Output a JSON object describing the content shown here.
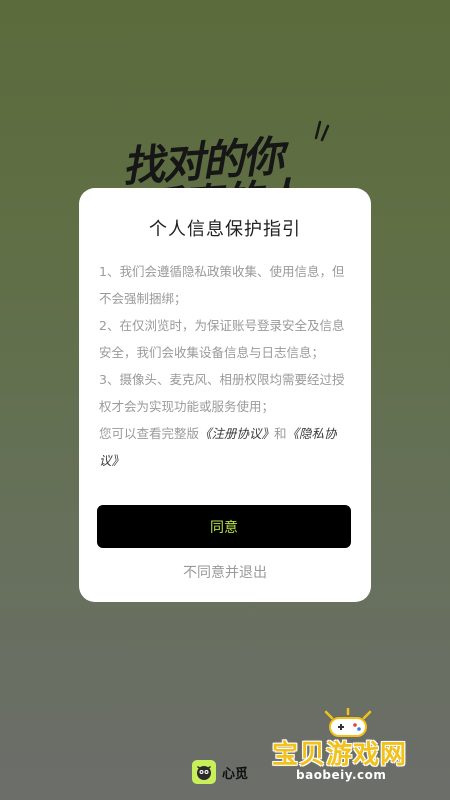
{
  "background": {
    "slogan_line1": "找对的你",
    "slogan_line2": "看真的人"
  },
  "dialog": {
    "title": "个人信息保护指引",
    "items": [
      "1、我们会遵循隐私政策收集、使用信息，但不会强制捆绑；",
      "2、在仅浏览时，为保证账号登录安全及信息安全，我们会收集设备信息与日志信息；",
      "3、摄像头、麦克风、相册权限均需要经过授权才会为实现功能或服务使用；"
    ],
    "footer_prefix": "您可以查看完整版",
    "register_link": "《注册协议》",
    "conjunction": "和",
    "privacy_link": "《隐私协议》",
    "agree_label": "同意",
    "disagree_label": "不同意并退出"
  },
  "brand": {
    "name": "心觅",
    "logo_color": "#c8ee5a"
  },
  "watermark": {
    "text": "宝贝游戏网",
    "url": "baobeiy.com"
  },
  "colors": {
    "accent": "#b6e04a",
    "button_bg": "#000000",
    "dialog_bg": "#ffffff",
    "bg_top": "#5b6b3c",
    "bg_bottom": "#6c6e6a"
  }
}
